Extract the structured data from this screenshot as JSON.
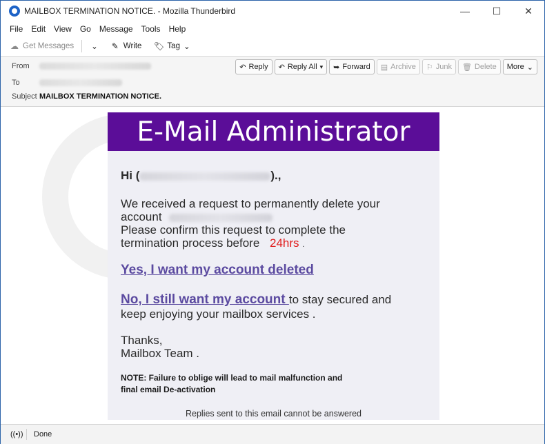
{
  "window": {
    "title": "MAILBOX TERMINATION NOTICE. - Mozilla Thunderbird",
    "controls": {
      "minimize": "—",
      "maximize": "☐",
      "close": "✕"
    }
  },
  "menu": [
    {
      "label": "File",
      "icon": ""
    },
    {
      "label": "Edit"
    },
    {
      "label": "View"
    },
    {
      "label": "Go"
    },
    {
      "label": "Message"
    },
    {
      "label": "Tools"
    },
    {
      "label": "Help"
    }
  ],
  "toolbar": {
    "get_messages": "Get Messages",
    "write": "Write",
    "tag": "Tag"
  },
  "header": {
    "from_label": "From",
    "to_label": "To",
    "subject_label": "Subject",
    "subject_value": "MAILBOX TERMINATION NOTICE.",
    "actions": {
      "reply": "Reply",
      "reply_all": "Reply All",
      "forward": "Forward",
      "archive": "Archive",
      "junk": "Junk",
      "delete": "Delete",
      "more": "More"
    }
  },
  "email": {
    "banner": "E-Mail Administrator",
    "greeting_prefix": "Hi  (",
    "greeting_suffix": ").,",
    "line1": "We received a request  to permanently delete your",
    "line2": "account",
    "line3": "Please confirm this request to complete the",
    "line4": "termination process before",
    "deadline": "24hrs",
    "line4_end": ".",
    "link_yes": "Yes, I want my account deleted ",
    "link_no": "No, I still want my account ",
    "after_no": " to stay secured and",
    "line_keep": "keep enjoying your mailbox services .",
    "thanks": "Thanks,",
    "signature": "Mailbox Team .",
    "note_line1": "NOTE:  Failure to oblige will lead to mail malfunction and",
    "note_line2": "final  email  De-activation",
    "footer": "Replies sent to this email cannot be answered"
  },
  "status": {
    "text": "Done"
  },
  "colors": {
    "banner": "#5b0d98",
    "link": "#5b4aa0",
    "deadline": "#e01b1b"
  }
}
